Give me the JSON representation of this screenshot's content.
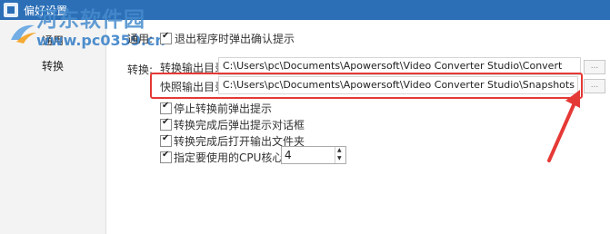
{
  "titlebar": {
    "title": "偏好设置"
  },
  "watermark": {
    "site_name": "河东软件园",
    "url": "www.pc0359.cn"
  },
  "sidebar": {
    "items": [
      {
        "label": "通用"
      },
      {
        "label": "转换"
      }
    ]
  },
  "general": {
    "section_label": "通用:",
    "exit_confirm_label": "退出程序时弹出确认提示"
  },
  "convert": {
    "section_label": "转换:",
    "output_dir_label": "转换输出目录:",
    "output_dir_value": "C:\\Users\\pc\\Documents\\Apowersoft\\Video Converter Studio\\Convert",
    "snapshot_dir_label": "快照输出目录:",
    "snapshot_dir_value": "C:\\Users\\pc\\Documents\\Apowersoft\\Video Converter Studio\\Snapshots",
    "browse_label": "...",
    "options": [
      {
        "label": "停止转换前弹出提示"
      },
      {
        "label": "转换完成后弹出提示对话框"
      },
      {
        "label": "转换完成后打开输出文件夹"
      }
    ],
    "cpu_label": "指定要使用的CPU核心数:",
    "cpu_value": "4"
  },
  "colors": {
    "titlebar": "#2c6fb7",
    "highlight": "#e53935"
  }
}
